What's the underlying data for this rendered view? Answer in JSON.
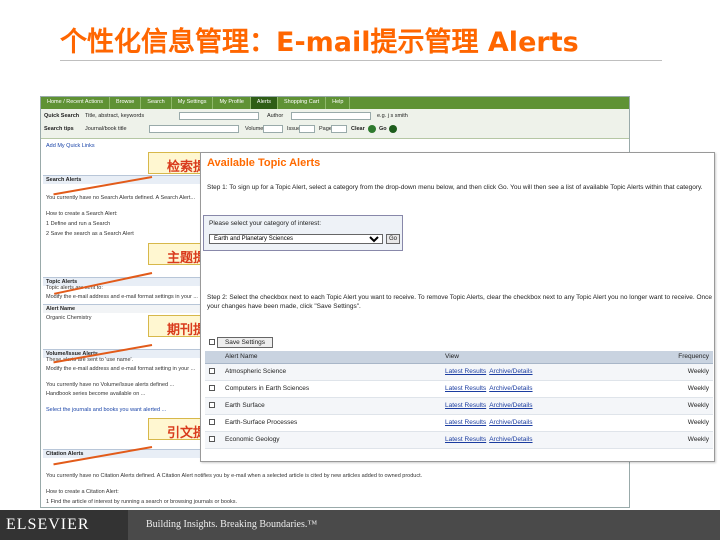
{
  "slide": {
    "title": "个性化信息管理：E-mail提示管理 Alerts"
  },
  "sd": {
    "nav": [
      "Home / Recent Actions",
      "Browse",
      "Search",
      "My Settings",
      "My Profile",
      "Alerts",
      "Shopping Cart",
      "Help"
    ],
    "quick_search_label": "Quick Search",
    "quick_search_value": "Title, abstract, keywords",
    "author_label": "Author",
    "author_hint": "e.g. j s smith",
    "source_label": "Search tips",
    "journal_value": "Journal/book title",
    "volume_label": "Volume",
    "issue_label": "Issue",
    "page_label": "Page",
    "clear_label": "Clear",
    "go_label": "Go",
    "add_link": "Add My Quick Links",
    "search_alerts": "Search Alerts",
    "search_alerts_text": "You currently have no Search Alerts defined. A Search Alert...",
    "search_howto": "How to create a Search Alert:",
    "search_step1": "1  Define and run a Search",
    "search_step2": "2  Save the search as a Search Alert",
    "topic_alerts": "Topic Alerts",
    "topic_text1": "Topic alerts are sent to:",
    "topic_text2": "Modify the e-mail address and e-mail format settings in your ...",
    "topic_alert_name": "Alert Name",
    "topic_alert_value": "Organic Chemistry",
    "volume_alerts": "Volume/Issue Alerts",
    "vol_text1": "These alerts are sent to 'use name'.",
    "vol_text2": "Modify the e-mail address and e-mail format setting in your ...",
    "vol_text3": "You currently have no Volume/Issue alerts defined ...",
    "vol_text4": "Handbook series become available on ...",
    "vol_text5": "Select the journals and books you want alerted ...",
    "citation_alerts": "Citation Alerts",
    "cit_text1": "You currently have no Citation Alerts defined. A Citation Alert notifies you by e-mail when a selected article is cited by new articles added to owned product.",
    "cit_howto": "How to create a Citation Alert:",
    "cit_step1": "1  Find the article of interest by running a search or browsing journals or books."
  },
  "callouts": [
    "检索提示",
    "主题提示",
    "期刊提示",
    "引文提示"
  ],
  "panel": {
    "title": "Available Topic Alerts",
    "step1": "Step 1: To sign up for a Topic Alert, select a category from the drop-down menu below, and then click Go. You will then see a list of available Topic Alerts within that category.",
    "cat_label": "Please select your category of interest:",
    "cat_selected": "Earth and Planetary Sciences",
    "go": "Go",
    "step2": "Step 2: Select the checkbox next to each Topic Alert you want to receive. To remove Topic Alerts, clear the checkbox next to any Topic Alert you no longer want to receive. Once your changes have been made, click \"Save Settings\".",
    "save": "Save Settings",
    "headers": {
      "name": "Alert Name",
      "view": "View",
      "frequency": "Frequency"
    },
    "rows": [
      {
        "name": "Atmospheric Science",
        "latest": "Latest Results",
        "archive": "Archive/Details",
        "freq": "Weekly"
      },
      {
        "name": "Computers in Earth Sciences",
        "latest": "Latest Results",
        "archive": "Archive/Details",
        "freq": "Weekly"
      },
      {
        "name": "Earth Surface",
        "latest": "Latest Results",
        "archive": "Archive/Details",
        "freq": "Weekly"
      },
      {
        "name": "Earth-Surface Processes",
        "latest": "Latest Results",
        "archive": "Archive/Details",
        "freq": "Weekly"
      },
      {
        "name": "Economic Geology",
        "latest": "Latest Results",
        "archive": "Archive/Details",
        "freq": "Weekly"
      }
    ]
  },
  "footer": {
    "logo": "ELSEVIER",
    "tagline": "Building Insights. Breaking Boundaries.™"
  }
}
